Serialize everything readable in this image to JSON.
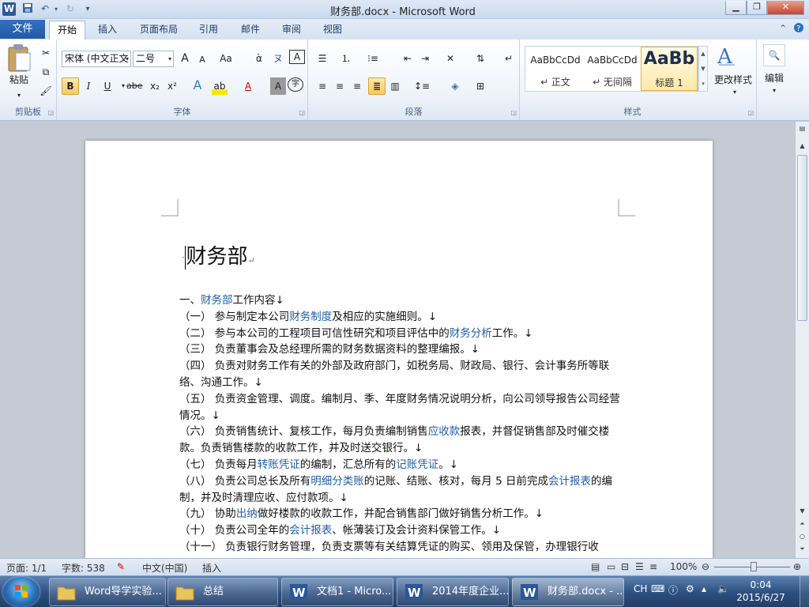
{
  "window": {
    "title": "财务部.docx - Microsoft Word",
    "app_icon": "W",
    "qat": {
      "undo_icon": "↶",
      "redo_icon": "↻",
      "customize_icon": "▾"
    }
  },
  "tabs": [
    "开始",
    "插入",
    "页面布局",
    "引用",
    "邮件",
    "审阅",
    "视图"
  ],
  "file_tab": "文件",
  "ribbon": {
    "clipboard": {
      "label": "剪贴板",
      "paste": "粘贴"
    },
    "font": {
      "label": "字体",
      "font_name": "宋体 (中文正文",
      "font_size": "二号",
      "grow": "A",
      "shrink": "A",
      "change_case": "Aa",
      "bold": "B",
      "italic": "I",
      "underline": "U",
      "strike": "abe",
      "subscript": "x₂",
      "superscript": "x²",
      "font_color_letter": "A",
      "char_border": "A",
      "enclose": "字"
    },
    "paragraph": {
      "label": "段落"
    },
    "styles": {
      "label": "样式",
      "items": [
        {
          "preview": "AaBbCcDd",
          "name": "↵ 正文"
        },
        {
          "preview": "AaBbCcDd",
          "name": "↵ 无间隔"
        },
        {
          "preview": "AaBb",
          "name": "标题 1"
        }
      ],
      "change_styles": "更改样式"
    },
    "editing": {
      "label": "编辑"
    }
  },
  "document": {
    "title": "财务部",
    "lines": [
      [
        "一、",
        {
          "link": "财务部"
        },
        "工作内容↓"
      ],
      [
        "（一）  参与制定本公司",
        {
          "link": "财务制度"
        },
        "及相应的实施细则。↓"
      ],
      [
        "（二）  参与本公司的工程项目可信性研究和项目评估中的",
        {
          "link": "财务分析"
        },
        "工作。↓"
      ],
      [
        "（三）  负责董事会及总经理所需的财务数据资料的整理编报。↓"
      ],
      [
        "（四）  负责对财务工作有关的外部及政府部门，如税务局、财政局、银行、会计事务所等联络、沟通工作。↓"
      ],
      [
        "（五）  负责资金管理、调度。编制月、季、年度财务情况说明分析，向公司领导报告公司经营情况。↓"
      ],
      [
        "（六）  负责销售统计、复核工作，每月负责编制销售",
        {
          "link": "应收款"
        },
        "报表，并督促销售部及时催交楼款。负责销售楼款的收款工作，并及时送交银行。↓"
      ],
      [
        "（七）  负责每月",
        {
          "link": "转账凭证"
        },
        "的编制，汇总所有的",
        {
          "link": "记账凭证"
        },
        "。↓"
      ],
      [
        "（八）  负责公司总长及所有",
        {
          "link": "明细分类账"
        },
        "的记账、结账、核对，每月 5 日前完成",
        {
          "link": "会计报表"
        },
        "的编制，并及时清理应收、应付款项。↓"
      ],
      [
        "（九）  协助",
        {
          "link": "出纳"
        },
        "做好楼款的收款工作，并配合销售部门做好销售分析工作。↓"
      ],
      [
        "（十）  负责公司全年的",
        {
          "link": "会计报表"
        },
        "、帐薄装订及会计资料保管工作。↓"
      ],
      [
        "（十一）  负责银行财务管理，负责支票等有关结算凭证的购买、领用及保管，办理银行收"
      ]
    ]
  },
  "statusbar": {
    "page": "页面: 1/1",
    "words": "字数: 538",
    "language": "中文(中国)",
    "mode": "插入",
    "zoom": "100%"
  },
  "taskbar": {
    "tasks": [
      {
        "label": "Word导学实验...",
        "icon": "folder-icon"
      },
      {
        "label": "总结",
        "icon": "folder-icon"
      },
      {
        "label": "文档1 - Micro...",
        "icon": "word-icon"
      },
      {
        "label": "2014年度企业...",
        "icon": "word-icon"
      },
      {
        "label": "财务部.docx - ...",
        "icon": "word-icon"
      }
    ],
    "ime": "CH",
    "time": "0:04",
    "date": "2015/6/27"
  },
  "colors": {
    "accent": "#2b579a",
    "link": "#1f5dad",
    "file_tab": "#2a62b0"
  }
}
